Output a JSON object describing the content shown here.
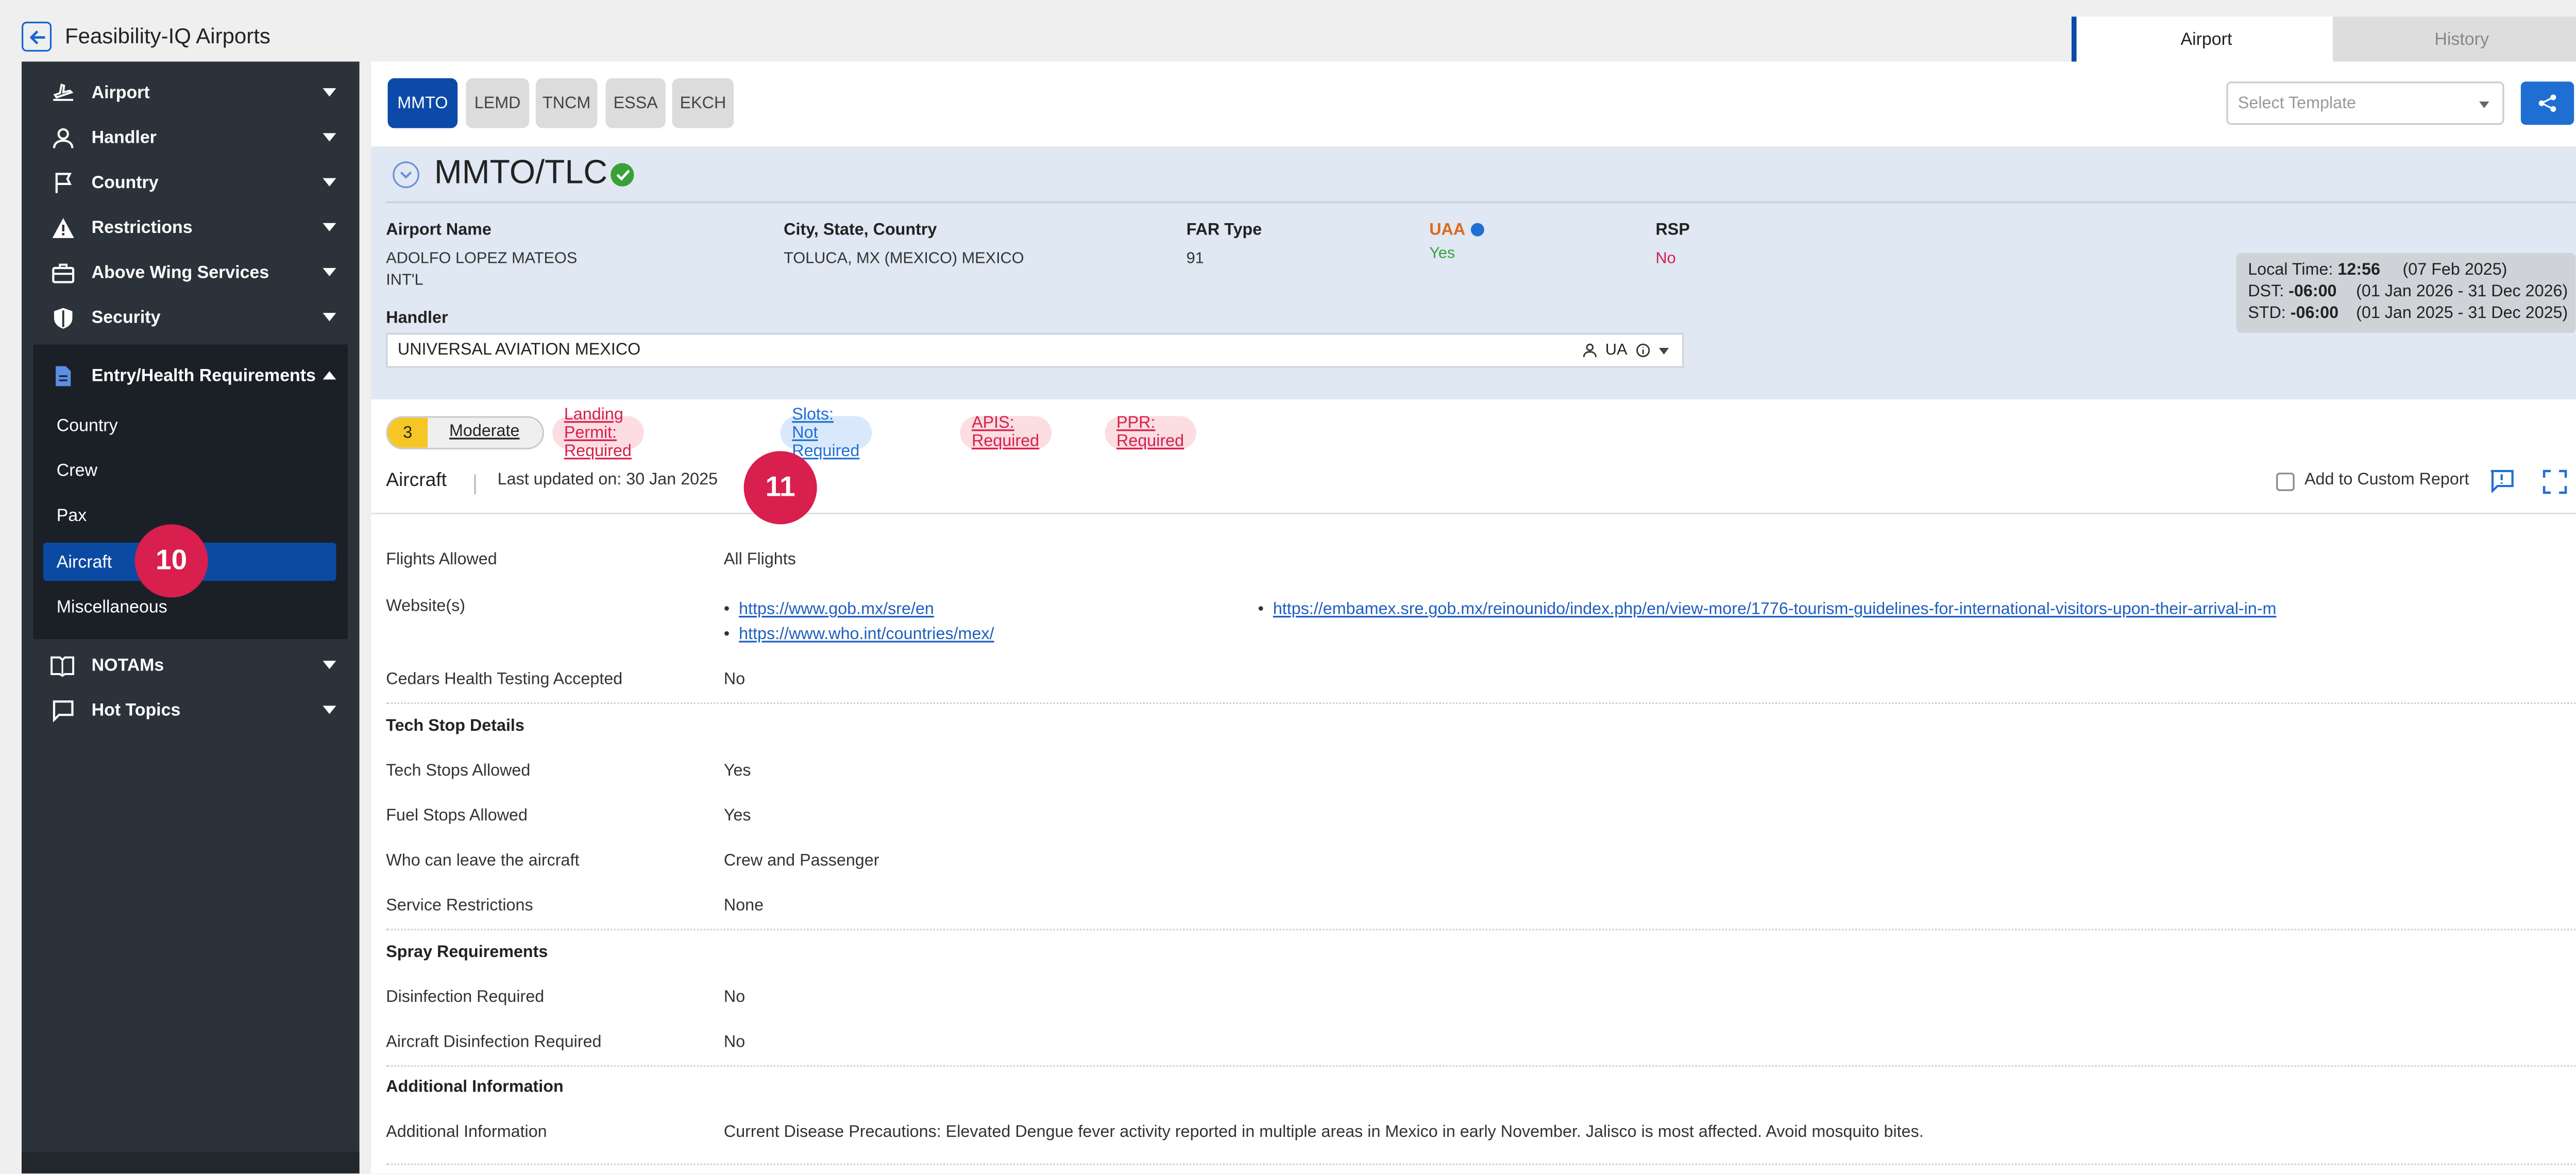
{
  "app": {
    "title": "Feasibility-IQ Airports"
  },
  "top_tabs": {
    "airport": "Airport",
    "history": "History"
  },
  "sidebar": {
    "items": [
      {
        "label": "Airport"
      },
      {
        "label": "Handler"
      },
      {
        "label": "Country"
      },
      {
        "label": "Restrictions"
      },
      {
        "label": "Above Wing Services"
      },
      {
        "label": "Security"
      },
      {
        "label": "Entry/Health Requirements"
      },
      {
        "label": "NOTAMs"
      },
      {
        "label": "Hot Topics"
      }
    ],
    "submenu": [
      "Country",
      "Crew",
      "Pax",
      "Aircraft",
      "Miscellaneous"
    ]
  },
  "airport_tabs": [
    "MMTO",
    "LEMD",
    "TNCM",
    "ESSA",
    "EKCH"
  ],
  "template": {
    "placeholder": "Select Template"
  },
  "airport": {
    "code": "MMTO/TLC",
    "fields": {
      "name_label": "Airport Name",
      "name_line1": "ADOLFO LOPEZ MATEOS",
      "name_line2": "INT'L",
      "city_label": "City, State, Country",
      "city_value": "TOLUCA, MX (MEXICO) MEXICO",
      "far_label": "FAR Type",
      "far_value": "91",
      "uaa_label": "UAA",
      "uaa_value": "Yes",
      "rsp_label": "RSP",
      "rsp_value": "No",
      "handler_label": "Handler",
      "handler_value": "UNIVERSAL AVIATION MEXICO",
      "handler_code": "UA"
    },
    "time": {
      "local_label": "Local Time:",
      "local_value": "12:56",
      "local_date": "(07 Feb 2025)",
      "dst_label": "DST:",
      "dst_value": "-06:00",
      "dst_range": "(01 Jan 2026 - 31 Dec 2026)",
      "std_label": "STD:",
      "std_value": "-06:00",
      "std_range": "(01 Jan 2025 - 31 Dec 2025)"
    }
  },
  "risk": {
    "number": "3",
    "level": "Moderate"
  },
  "pills": [
    {
      "label": "Landing Permit: Required"
    },
    {
      "label": "Slots: Not Required"
    },
    {
      "label": "APIS: Required"
    },
    {
      "label": "PPR: Required"
    }
  ],
  "section": {
    "title": "Aircraft",
    "updated": "Last updated on: 30 Jan 2025",
    "custom_report": "Add to Custom Report"
  },
  "details": {
    "flights_allowed_label": "Flights Allowed",
    "flights_allowed_value": "All Flights",
    "websites_label": "Website(s)",
    "websites": [
      "https://www.gob.mx/sre/en",
      "https://www.who.int/countries/mex/",
      "https://embamex.sre.gob.mx/reinounido/index.php/en/view-more/1776-tourism-guidelines-for-international-visitors-upon-their-arrival-in-m"
    ],
    "cedars_label": "Cedars Health Testing Accepted",
    "cedars_value": "No",
    "tech_heading": "Tech Stop Details",
    "tech_stops_label": "Tech Stops Allowed",
    "tech_stops_value": "Yes",
    "fuel_stops_label": "Fuel Stops Allowed",
    "fuel_stops_value": "Yes",
    "who_leave_label": "Who can leave the aircraft",
    "who_leave_value": "Crew and Passenger",
    "service_label": "Service Restrictions",
    "service_value": "None",
    "spray_heading": "Spray Requirements",
    "disinfection_label": "Disinfection Required",
    "disinfection_value": "No",
    "aircraft_disinfection_label": "Aircraft Disinfection Required",
    "aircraft_disinfection_value": "No",
    "additional_heading": "Additional Information",
    "additional_label": "Additional Information",
    "additional_value": "Current Disease Precautions: Elevated Dengue fever activity reported in multiple areas in Mexico in early November. Jalisco is most affected. Avoid mosquito bites."
  },
  "markers": {
    "m10": "10",
    "m11": "11"
  }
}
